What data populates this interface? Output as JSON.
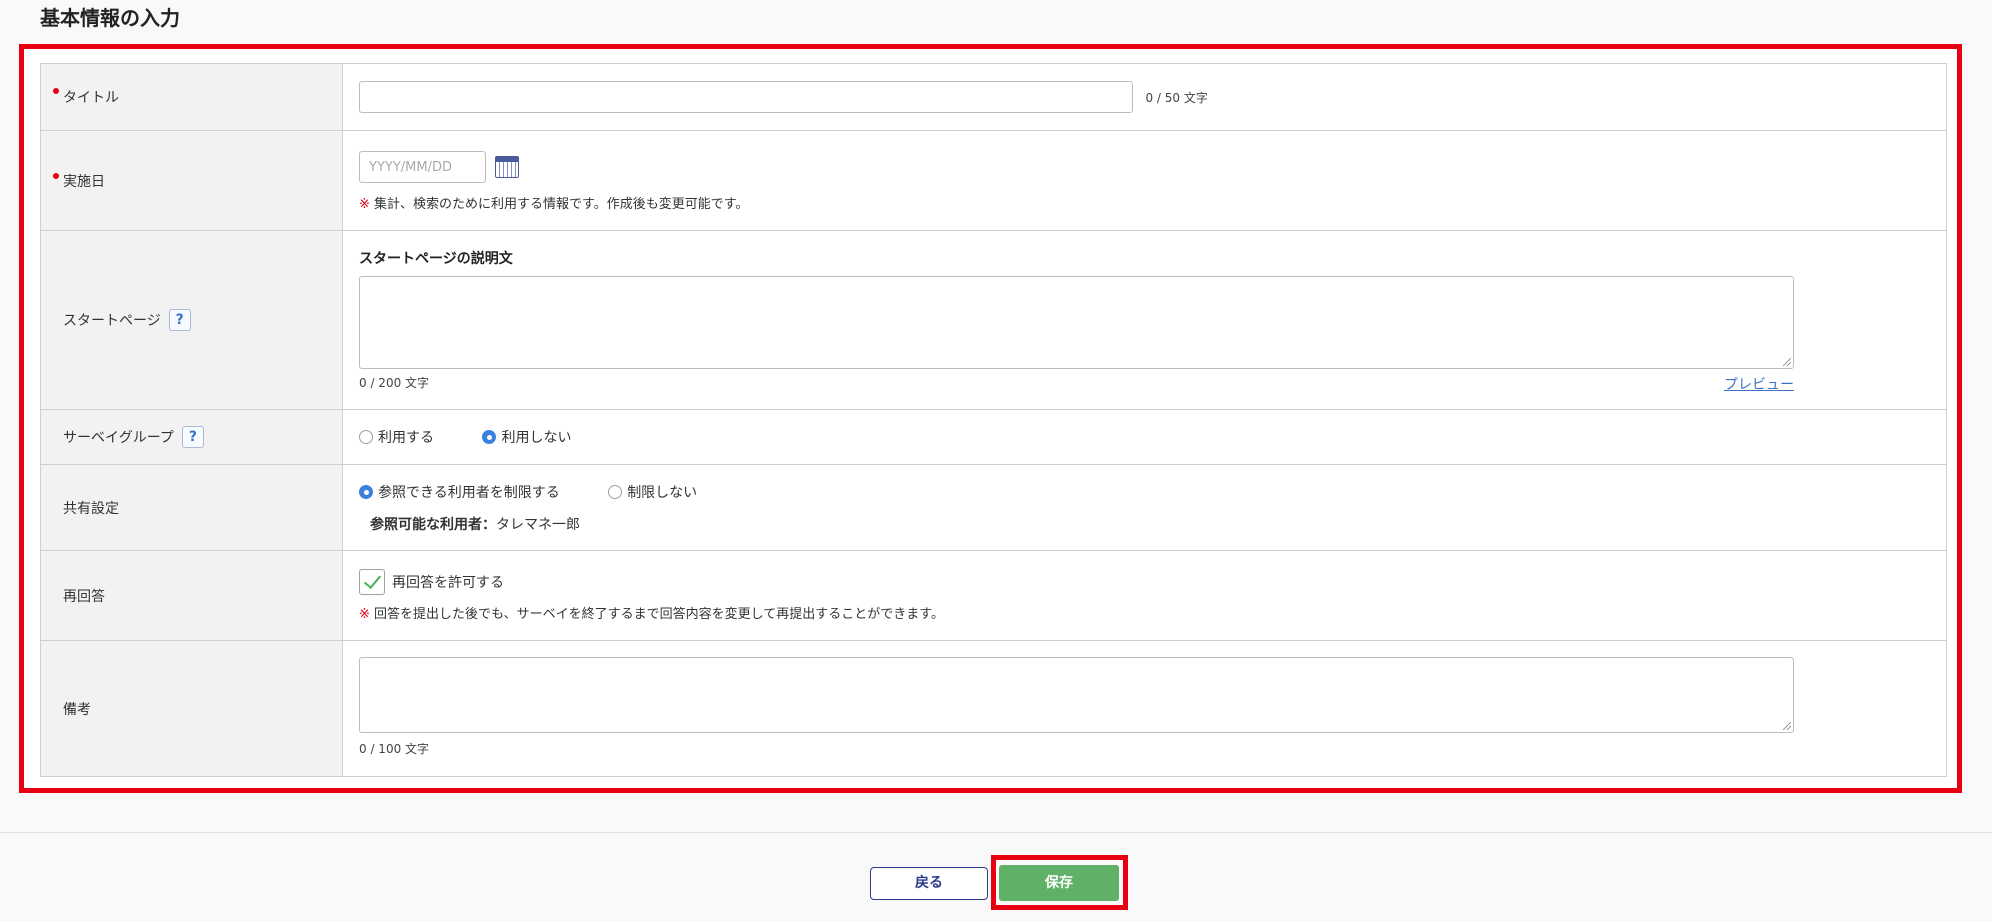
{
  "section": {
    "title": "基本情報の入力"
  },
  "rows": {
    "title": {
      "label": "タイトル",
      "counter": "0 / 50 文字",
      "value": ""
    },
    "date": {
      "label": "実施日",
      "placeholder": "YYYY/MM/DD",
      "note_mark": "※",
      "note": " 集計、検索のために利用する情報です。作成後も変更可能です。"
    },
    "start_page": {
      "label": "スタートページ",
      "help": "?",
      "subhead": "スタートページの説明文",
      "counter": "0 / 200 文字",
      "preview": "プレビュー"
    },
    "survey_group": {
      "label": "サーベイグループ",
      "help": "?",
      "options": [
        "利用する",
        "利用しない"
      ],
      "selected": "利用しない"
    },
    "sharing": {
      "label": "共有設定",
      "options": [
        "参照できる利用者を制限する",
        "制限しない"
      ],
      "selected": "参照できる利用者を制限する",
      "viewers_label": "参照可能な利用者：",
      "viewers_value": "タレマネ一郎"
    },
    "reanswer": {
      "label": "再回答",
      "checkbox_label": "再回答を許可する",
      "checked": true,
      "note_mark": "※",
      "note": " 回答を提出した後でも、サーベイを終了するまで回答内容を変更して再提出することができます。"
    },
    "remarks": {
      "label": "備考",
      "counter": "0 / 100 文字"
    }
  },
  "footer": {
    "back": "戻る",
    "save": "保存"
  },
  "colors": {
    "highlight": "#e60012",
    "save_button": "#5fb167",
    "accent": "#3b82e0"
  }
}
